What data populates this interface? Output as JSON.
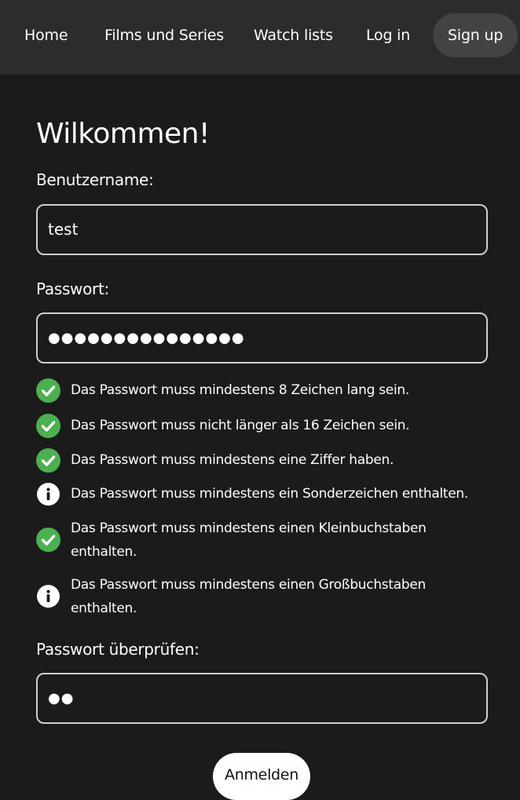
{
  "nav": {
    "home": "Home",
    "films": "Films und Series",
    "watchlists": "Watch lists",
    "login": "Log in",
    "signup": "Sign up"
  },
  "form": {
    "title": "Wilkommen!",
    "username_label": "Benutzername:",
    "username_value": "test",
    "password_label": "Passwort:",
    "password_value": "●●●●●●●●●●●●●●●",
    "confirm_label": "Passwort überprüfen:",
    "confirm_value": "●●",
    "submit_label": "Anmelden"
  },
  "rules": [
    {
      "text": "Das Passwort muss mindestens 8 Zeichen lang sein.",
      "status": "ok",
      "icon": "check-circle-icon",
      "color": "#4caf50"
    },
    {
      "text": "Das Passwort muss nicht länger als 16 Zeichen sein.",
      "status": "ok",
      "icon": "check-circle-icon",
      "color": "#4caf50"
    },
    {
      "text": "Das Passwort muss mindestens eine Ziffer haben.",
      "status": "ok",
      "icon": "check-circle-icon",
      "color": "#4caf50"
    },
    {
      "text": "Das Passwort muss mindestens ein Sonderzeichen enthalten.",
      "status": "info",
      "icon": "info-circle-icon",
      "color": "#ffffff"
    },
    {
      "text": "Das Passwort muss mindestens einen Kleinbuchstaben enthalten.",
      "status": "ok",
      "icon": "check-circle-icon",
      "color": "#4caf50"
    },
    {
      "text": "Das Passwort muss mindestens einen Großbuchstaben enthalten.",
      "status": "info",
      "icon": "info-circle-icon",
      "color": "#ffffff"
    }
  ],
  "colors": {
    "background": "#1b1b1b",
    "navbar": "#2c2c2c",
    "active_nav": "#434343",
    "ok": "#4caf50",
    "field_border": "#cfcfcf"
  }
}
